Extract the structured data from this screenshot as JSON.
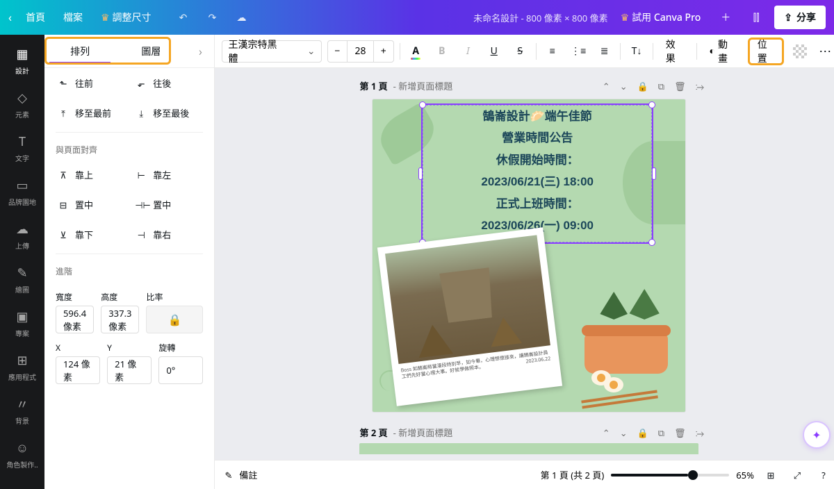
{
  "topbar": {
    "home": "首頁",
    "file": "檔案",
    "resize": "調整尺寸",
    "docname": "未命名設計 - 800 像素 × 800 像素",
    "tryPro": "試用 Canva Pro",
    "share": "分享"
  },
  "rail": {
    "items": [
      {
        "label": "設計",
        "icon": "▦"
      },
      {
        "label": "元素",
        "icon": "◇"
      },
      {
        "label": "文字",
        "icon": "T"
      },
      {
        "label": "品牌園地",
        "icon": "▭"
      },
      {
        "label": "上傳",
        "icon": "☁"
      },
      {
        "label": "繪圖",
        "icon": "✎"
      },
      {
        "label": "專案",
        "icon": "▣"
      },
      {
        "label": "應用程式",
        "icon": "⊞"
      },
      {
        "label": "背景",
        "icon": "〃"
      },
      {
        "label": "角色製作..",
        "icon": "☺"
      }
    ]
  },
  "panel": {
    "tabs": {
      "arrange": "排列",
      "layers": "圖層"
    },
    "order": {
      "forward": "往前",
      "backward": "往後",
      "front": "移至最前",
      "back": "移至最後"
    },
    "alignHeader": "與頁面對齊",
    "align": {
      "top": "靠上",
      "middle": "置中",
      "bottom": "靠下",
      "left": "靠左",
      "center": "置中",
      "right": "靠右"
    },
    "advHeader": "進階",
    "adv": {
      "widthLabel": "寬度",
      "width": "596.4 像素",
      "heightLabel": "高度",
      "height": "337.3 像素",
      "ratioLabel": "比率",
      "xLabel": "X",
      "x": "124 像素",
      "yLabel": "Y",
      "y": "21 像素",
      "rotLabel": "旋轉",
      "rot": "0°"
    }
  },
  "toolbar": {
    "font": "王漢宗特黑體",
    "size": "28",
    "effects": "效果",
    "animate": "動畫",
    "position": "位置"
  },
  "pages": {
    "p1num": "第 1 頁",
    "p1title": "- 新增頁面標題",
    "p2num": "第 2 頁",
    "p2title": "- 新增頁面標題"
  },
  "art": {
    "l1": "鵠崙設計🥟端午佳節",
    "l2": "營業時間公告",
    "l3": "休假開始時間：",
    "l4": "2023/06/21(三)  18:00",
    "l5": "正式上班時間：",
    "l6": "2023/06/26(一)  09:00",
    "polaroidCap": "Boss 如鵠崙將當漫段特別早，如今畢，心理想懷接來，讓鵠崙設計員工們先好當心理大事。好就學做照本。",
    "polaroidDate": "2023.06.22"
  },
  "bottom": {
    "notes": "備註",
    "pageinfo": "第 1 頁 (共 2 頁)",
    "zoom": "65%"
  }
}
